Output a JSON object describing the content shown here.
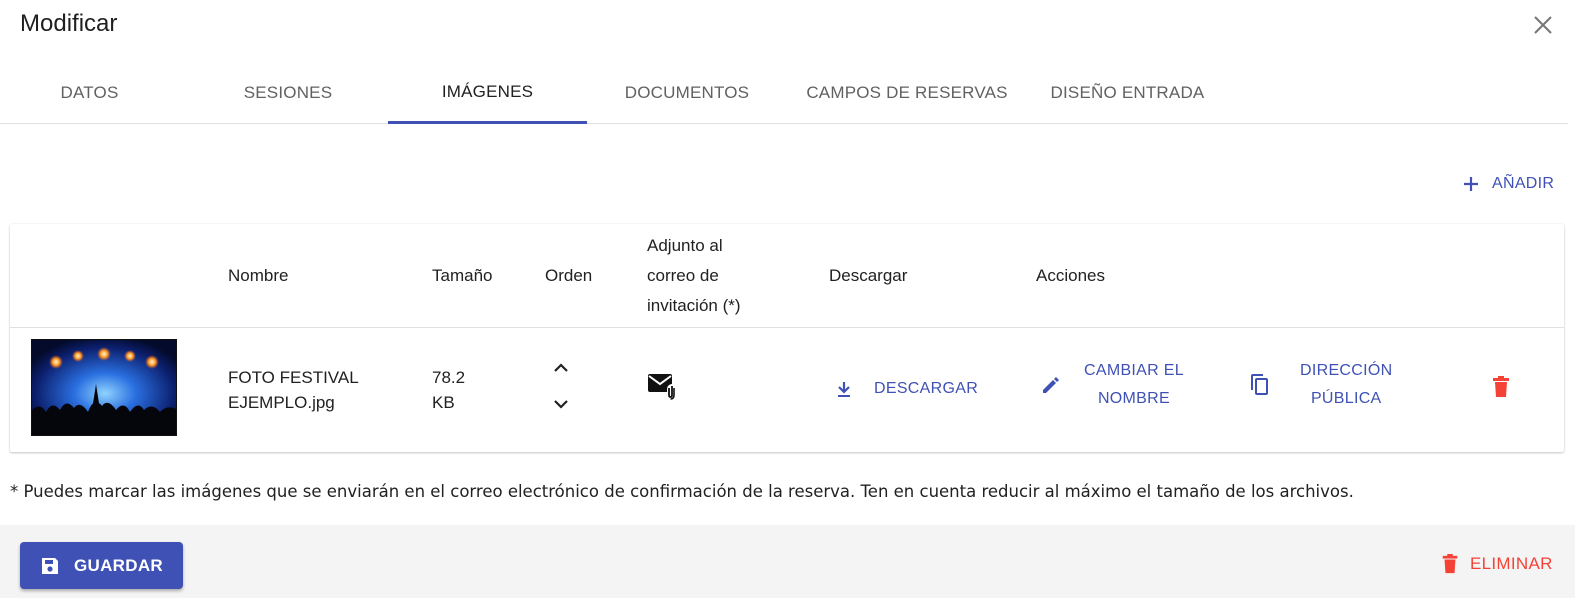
{
  "dialog": {
    "title": "Modificar"
  },
  "tabs": [
    {
      "label": "DATOS"
    },
    {
      "label": "SESIONES"
    },
    {
      "label": "IMÁGENES",
      "active": true
    },
    {
      "label": "DOCUMENTOS"
    },
    {
      "label": "CAMPOS DE RESERVAS"
    },
    {
      "label": "DISEÑO ENTRADA"
    }
  ],
  "toolbar": {
    "add_label": "AÑADIR"
  },
  "table": {
    "headers": {
      "name": "Nombre",
      "size": "Tamaño",
      "order": "Orden",
      "attach_line1": "Adjunto al",
      "attach_line2": "correo de",
      "attach_line3": "invitación (*)",
      "download": "Descargar",
      "actions": "Acciones"
    },
    "rows": [
      {
        "name_line1": "FOTO FESTIVAL",
        "name_line2": "EJEMPLO.jpg",
        "size_line1": "78.2",
        "size_line2": "KB",
        "download_label": "DESCARGAR",
        "rename_line1": "CAMBIAR EL",
        "rename_line2": "NOMBRE",
        "public_line1": "DIRECCIÓN",
        "public_line2": "PÚBLICA"
      }
    ]
  },
  "footnote": "* Puedes marcar las imágenes que se enviarán en el correo electrónico de confirmación de la reserva. Ten en cuenta reducir al máximo el tamaño de los archivos.",
  "footer": {
    "save_label": "GUARDAR",
    "delete_label": "ELIMINAR"
  },
  "colors": {
    "primary": "#3f51b5",
    "danger": "#f44336",
    "footer_bg": "#f4f4f4"
  }
}
